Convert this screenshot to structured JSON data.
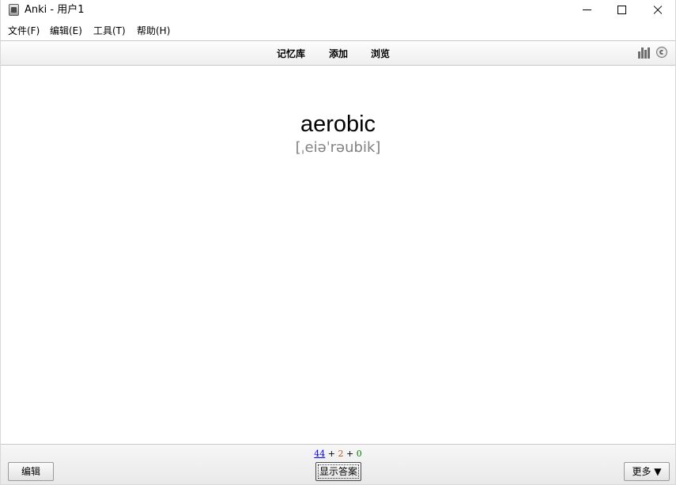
{
  "window": {
    "title": "Anki - 用户1"
  },
  "menu": {
    "items": [
      {
        "label": "文件(F)"
      },
      {
        "label": "编辑(E)"
      },
      {
        "label": "工具(T)"
      },
      {
        "label": "帮助(H)"
      }
    ]
  },
  "toolbar": {
    "links": [
      {
        "label": "记忆库"
      },
      {
        "label": "添加"
      },
      {
        "label": "浏览"
      }
    ],
    "stats_icon": "bar-chart-icon",
    "sync_icon": "sync-icon"
  },
  "card": {
    "word": "aerobic",
    "phonetic": "[ˌeiəˈrəubik]"
  },
  "counts": {
    "new": "44",
    "learning": "2",
    "review": "0",
    "separator": "+",
    "colors": {
      "new": "#0000ff",
      "learning": "#c35617",
      "review": "#008000"
    }
  },
  "bottom": {
    "edit_label": "编辑",
    "show_answer_label": "显示答案",
    "more_label": "更多 ▼"
  }
}
